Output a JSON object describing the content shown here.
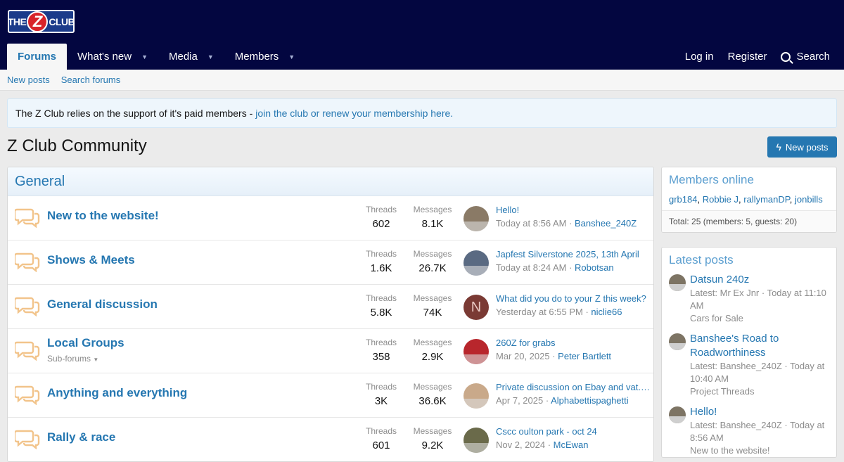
{
  "header": {
    "logo_left": "THE",
    "logo_mid": "Z",
    "logo_right": "CLUB"
  },
  "nav": {
    "tabs": [
      {
        "label": "Forums",
        "active": true
      },
      {
        "label": "What's new"
      },
      {
        "label": "Media"
      },
      {
        "label": "Members"
      }
    ],
    "login": "Log in",
    "register": "Register",
    "search": "Search"
  },
  "subnav": {
    "new_posts": "New posts",
    "search_forums": "Search forums"
  },
  "notice": {
    "text": "The Z Club relies on the support of it's paid members -",
    "link": "join the club or renew your membership here."
  },
  "page": {
    "title": "Z Club Community",
    "new_posts_button": "New posts"
  },
  "forum": {
    "category": "General",
    "threads_label": "Threads",
    "messages_label": "Messages",
    "nodes": [
      {
        "title": "New to the website!",
        "threads": "602",
        "messages": "8.1K",
        "latest_title": "Hello!",
        "latest_time": "Today at 8:56 AM",
        "latest_user": "Banshee_240Z",
        "avatar_color": "#8a7a66"
      },
      {
        "title": "Shows & Meets",
        "threads": "1.6K",
        "messages": "26.7K",
        "latest_title": "Japfest Silverstone 2025, 13th April",
        "latest_time": "Today at 8:24 AM",
        "latest_user": "Robotsan",
        "avatar_color": "#5a6a82"
      },
      {
        "title": "General discussion",
        "threads": "5.8K",
        "messages": "74K",
        "latest_title": "What did you do to your Z this week?",
        "latest_time": "Yesterday at 6:55 PM",
        "latest_user": "niclie66",
        "avatar_letter": "N",
        "avatar_color": "#7a3a34"
      },
      {
        "title": "Local Groups",
        "subforums": "Sub-forums",
        "threads": "358",
        "messages": "2.9K",
        "latest_title": "260Z for grabs",
        "latest_time": "Mar 20, 2025",
        "latest_user": "Peter Bartlett",
        "avatar_color": "#b8262c"
      },
      {
        "title": "Anything and everything",
        "threads": "3K",
        "messages": "36.6K",
        "latest_title": "Private discussion on Ebay and vat. ...",
        "latest_time": "Apr 7, 2025",
        "latest_user": "Alphabettispaghetti",
        "avatar_color": "#c9a98a"
      },
      {
        "title": "Rally & race",
        "threads": "601",
        "messages": "9.2K",
        "latest_title": "Cscc oulton park - oct 24",
        "latest_time": "Nov 2, 2024",
        "latest_user": "McEwan",
        "avatar_color": "#6a6a4a"
      }
    ]
  },
  "members_online": {
    "title": "Members online",
    "names": [
      "grb184",
      "Robbie J",
      "rallymanDP",
      "jonbills"
    ],
    "total": "Total: 25 (members: 5, guests: 20)"
  },
  "latest_posts": {
    "title": "Latest posts",
    "items": [
      {
        "title": "Datsun 240z",
        "meta": "Latest: Mr Ex Jnr · Today at 11:10 AM",
        "forum": "Cars for Sale"
      },
      {
        "title": "Banshee's Road to Roadworthiness",
        "meta": "Latest: Banshee_240Z · Today at 10:40 AM",
        "forum": "Project Threads"
      },
      {
        "title": "Hello!",
        "meta": "Latest: Banshee_240Z · Today at 8:56 AM",
        "forum": "New to the website!"
      }
    ]
  },
  "colors": {
    "header_bg": "#030640",
    "link": "#2577b1",
    "button": "#2577b1",
    "icon": "#f2c48b"
  }
}
